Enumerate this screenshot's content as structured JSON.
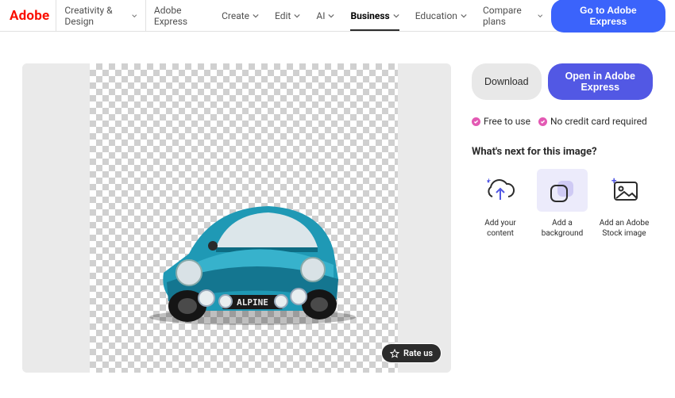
{
  "logo": "Adobe",
  "nav": [
    {
      "label": "Creativity & Design",
      "active": false,
      "dropdown": true
    },
    {
      "label": "Adobe Express",
      "active": false,
      "dropdown": false
    },
    {
      "label": "Create",
      "active": false,
      "dropdown": true
    },
    {
      "label": "Edit",
      "active": false,
      "dropdown": true
    },
    {
      "label": "AI",
      "active": false,
      "dropdown": true
    },
    {
      "label": "Business",
      "active": true,
      "dropdown": true
    },
    {
      "label": "Education",
      "active": false,
      "dropdown": true
    },
    {
      "label": "Compare plans",
      "active": false,
      "dropdown": true
    }
  ],
  "cta": "Go to Adobe Express",
  "canvas": {
    "plate": "ALPINE",
    "rate_label": "Rate us"
  },
  "side": {
    "download": "Download",
    "open": "Open in Adobe Express",
    "badges": [
      {
        "text": "Free to use"
      },
      {
        "text": "No credit card required"
      }
    ],
    "heading": "What's next for this image?",
    "cards": [
      {
        "label": "Add your content"
      },
      {
        "label": "Add a background"
      },
      {
        "label": "Add an Adobe Stock image"
      }
    ]
  }
}
